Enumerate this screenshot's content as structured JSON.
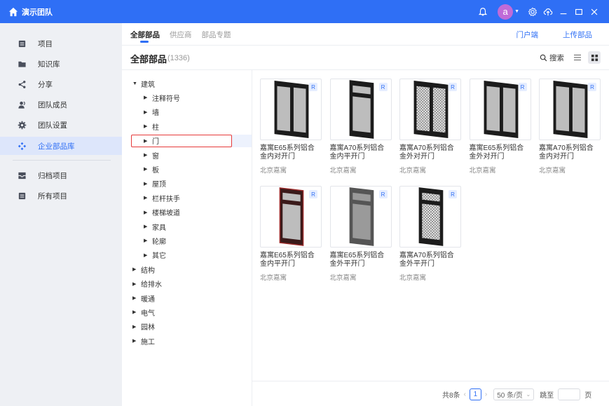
{
  "titlebar": {
    "team_name": "演示团队",
    "avatar_letter": "a"
  },
  "sidebar": {
    "items": [
      {
        "label": "项目",
        "icon": "project-icon"
      },
      {
        "label": "知识库",
        "icon": "folder-icon"
      },
      {
        "label": "分享",
        "icon": "share-icon"
      },
      {
        "label": "团队成员",
        "icon": "members-icon"
      },
      {
        "label": "团队设置",
        "icon": "gear-icon"
      },
      {
        "label": "企业部品库",
        "icon": "parts-library-icon"
      },
      {
        "label": "归档项目",
        "icon": "archive-icon"
      },
      {
        "label": "所有项目",
        "icon": "all-projects-icon"
      }
    ]
  },
  "header": {
    "tabs": [
      "全部部品",
      "供应商",
      "部品专题"
    ],
    "links": [
      "门户端",
      "上传部品"
    ],
    "title": "全部部品",
    "count": "(1336)",
    "search_label": "搜索"
  },
  "tree": {
    "items": [
      {
        "label": "建筑",
        "level": 0,
        "expanded": true
      },
      {
        "label": "注释符号",
        "level": 1
      },
      {
        "label": "墙",
        "level": 1
      },
      {
        "label": "柱",
        "level": 1
      },
      {
        "label": "门",
        "level": 1,
        "selected": true
      },
      {
        "label": "窗",
        "level": 1
      },
      {
        "label": "板",
        "level": 1
      },
      {
        "label": "屋顶",
        "level": 1
      },
      {
        "label": "栏杆扶手",
        "level": 1
      },
      {
        "label": "楼梯坡道",
        "level": 1
      },
      {
        "label": "家具",
        "level": 1
      },
      {
        "label": "轮廓",
        "level": 1
      },
      {
        "label": "其它",
        "level": 1
      },
      {
        "label": "结构",
        "level": 0
      },
      {
        "label": "给排水",
        "level": 0
      },
      {
        "label": "暖通",
        "level": 0
      },
      {
        "label": "电气",
        "level": 0
      },
      {
        "label": "园林",
        "level": 0
      },
      {
        "label": "施工",
        "level": 0
      }
    ]
  },
  "cards": [
    {
      "name_line1": "嘉寓E65系列铝合",
      "name_line2": "金内对开门",
      "brand": "北京嘉寓",
      "badge": "R",
      "style": "double-black"
    },
    {
      "name_line1": "嘉寓A70系列铝合",
      "name_line2": "金内平开门",
      "brand": "北京嘉寓",
      "badge": "R",
      "style": "single-transom-black"
    },
    {
      "name_line1": "嘉寓A70系列铝合",
      "name_line2": "金外对开门",
      "brand": "北京嘉寓",
      "badge": "R",
      "style": "double-pattern"
    },
    {
      "name_line1": "嘉寓E65系列铝合",
      "name_line2": "金外对开门",
      "brand": "北京嘉寓",
      "badge": "R",
      "style": "double-black"
    },
    {
      "name_line1": "嘉寓A70系列铝合",
      "name_line2": "金内对开门",
      "brand": "北京嘉寓",
      "badge": "R",
      "style": "double-black"
    },
    {
      "name_line1": "嘉寓E65系列铝合",
      "name_line2": "金内平开门",
      "brand": "北京嘉寓",
      "badge": "R",
      "style": "single-transom-red"
    },
    {
      "name_line1": "嘉寓E65系列铝合",
      "name_line2": "金外平开门",
      "brand": "北京嘉寓",
      "badge": "R",
      "style": "single-transom-gray"
    },
    {
      "name_line1": "嘉寓A70系列铝合",
      "name_line2": "金外平开门",
      "brand": "北京嘉寓",
      "badge": "R",
      "style": "single-transom-pattern"
    }
  ],
  "pagination": {
    "total": "共8条",
    "current_page": "1",
    "page_size": "50 条/页",
    "goto_label": "跳至",
    "page_suffix": "页"
  },
  "colors": {
    "accent": "#2f6ff5",
    "sidebar_bg": "#eef0f4",
    "highlight_box": "#e63a3a"
  }
}
